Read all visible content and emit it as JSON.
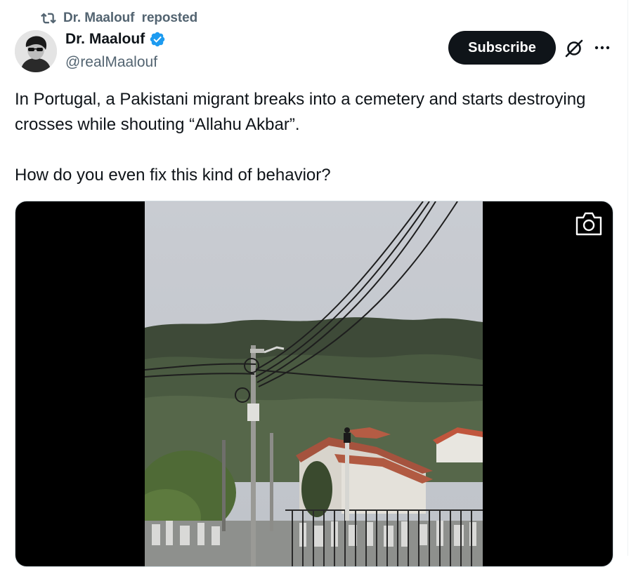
{
  "repost": {
    "icon": "repost-icon",
    "label": "Dr. Maalouf  reposted"
  },
  "author": {
    "avatar_icon": "avatar-photo",
    "name": "Dr. Maalouf",
    "verified_icon": "verified-badge-icon",
    "handle": "@realMaalouf"
  },
  "actions": {
    "subscribe_label": "Subscribe",
    "grok_icon": "grok-icon",
    "more_icon": "more-options-icon"
  },
  "tweet": {
    "line1": "In Portugal, a Pakistani migrant breaks into a cemetery and starts destroying crosses while shouting “Allahu Akbar”.",
    "line2": "How do you even fix this kind of behavior?"
  },
  "media": {
    "type": "video",
    "camera_icon": "camera-icon"
  },
  "colors": {
    "text_primary": "#0f1419",
    "text_secondary": "#536471",
    "verified_blue": "#1d9bf0",
    "button_bg": "#0f1419",
    "border": "#cfd9de"
  }
}
